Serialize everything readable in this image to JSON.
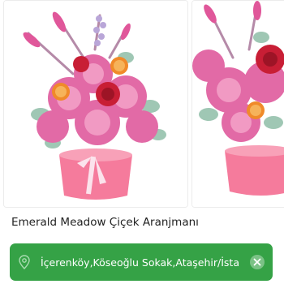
{
  "product": {
    "title": "Emerald Meadow Çiçek Aranjmanı",
    "images": [
      {
        "alt": "Pink flower arrangement in pink box"
      },
      {
        "alt": "Flower arrangement alternate view"
      }
    ]
  },
  "location_bar": {
    "address": "İçerenköy,Köseoğlu Sokak,Ataşehir/İstanbul",
    "pin_icon": "location-pin-icon",
    "close_icon": "close-icon",
    "background_color": "#35a246"
  }
}
